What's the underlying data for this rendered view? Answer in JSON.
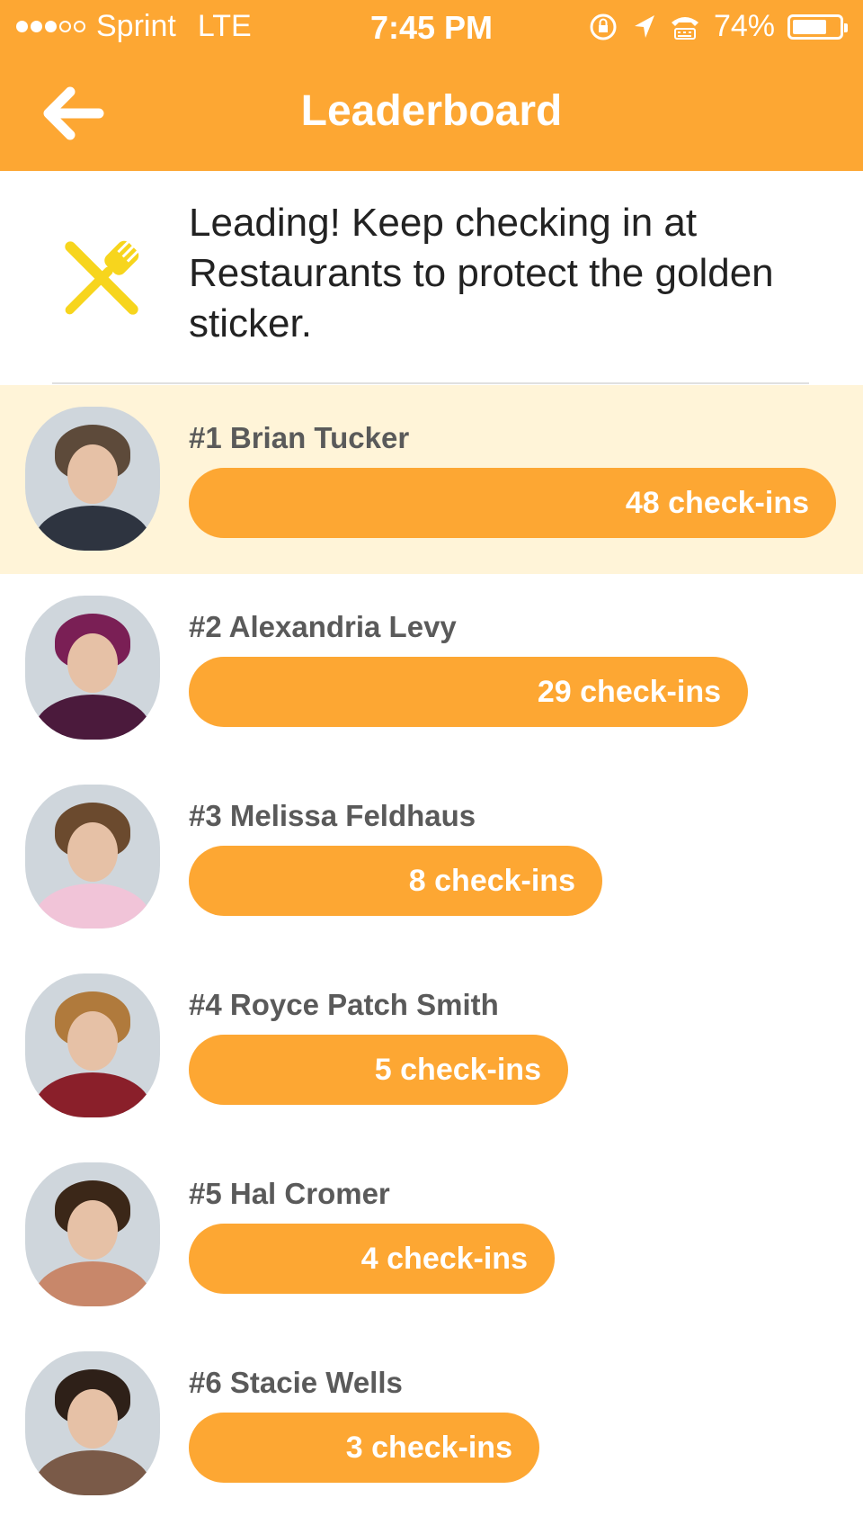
{
  "status_bar": {
    "carrier": "Sprint",
    "network": "LTE",
    "time": "7:45 PM",
    "battery": "74%",
    "battery_level": 0.74
  },
  "header": {
    "title": "Leaderboard"
  },
  "intro": {
    "message": "Leading! Keep checking in at Restaurants to protect the golden sticker."
  },
  "leaders": [
    {
      "name": "#1 Brian Tucker",
      "checkins": "48 check-ins",
      "checkin_count": 48,
      "highlight": true,
      "hair": "#5d4a3a",
      "shirt": "#2e3440"
    },
    {
      "name": "#2 Alexandria Levy",
      "checkins": "29 check-ins",
      "checkin_count": 29,
      "highlight": false,
      "hair": "#7a1f55",
      "shirt": "#4b1a3c"
    },
    {
      "name": "#3 Melissa Feldhaus",
      "checkins": "8 check-ins",
      "checkin_count": 8,
      "highlight": false,
      "hair": "#6b4a2e",
      "shirt": "#f1c4d8"
    },
    {
      "name": "#4 Royce Patch Smith",
      "checkins": "5 check-ins",
      "checkin_count": 5,
      "highlight": false,
      "hair": "#b07a3c",
      "shirt": "#8a1f2a"
    },
    {
      "name": "#5 Hal Cromer",
      "checkins": "4 check-ins",
      "checkin_count": 4,
      "highlight": false,
      "hair": "#3b2718",
      "shirt": "#c8876a"
    },
    {
      "name": "#6 Stacie Wells",
      "checkins": "3 check-ins",
      "checkin_count": 3,
      "highlight": false,
      "hair": "#2e2018",
      "shirt": "#7a5a48"
    }
  ],
  "colors": {
    "accent": "#fda733",
    "highlight_row": "#fff4d8",
    "icon_yellow": "#f7d51d"
  },
  "icons": {
    "back": "back-arrow-icon",
    "category": "fork-knife-icon"
  }
}
